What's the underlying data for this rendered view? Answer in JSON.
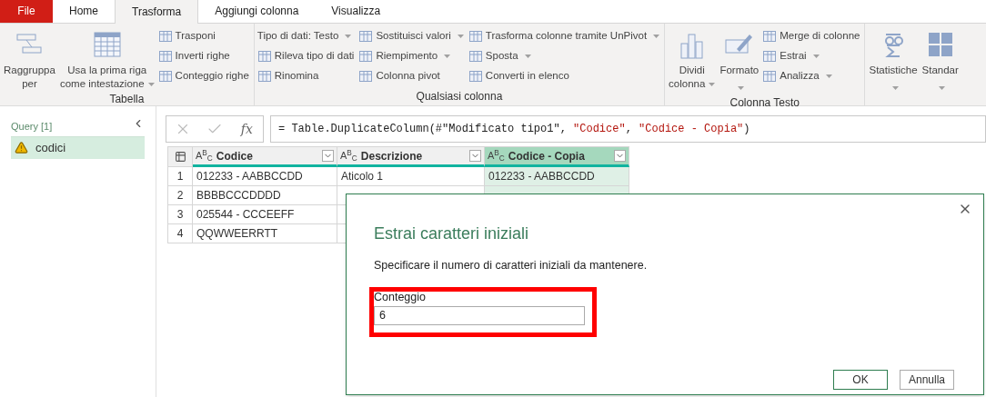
{
  "menu_tabs": [
    {
      "label": "File",
      "kind": "file",
      "selected": false
    },
    {
      "label": "Home",
      "kind": "tab",
      "selected": false
    },
    {
      "label": "Trasforma",
      "kind": "tab",
      "selected": true
    },
    {
      "label": "Aggiungi colonna",
      "kind": "tab",
      "selected": false
    },
    {
      "label": "Visualizza",
      "kind": "tab",
      "selected": false
    }
  ],
  "ribbon": {
    "groups": [
      {
        "label": "Tabella",
        "columns": [
          {
            "kind": "large",
            "lines": [
              "Raggruppa",
              "per"
            ],
            "dropdown": false
          },
          {
            "kind": "large",
            "lines": [
              "Usa la prima riga",
              "come intestazione"
            ],
            "dropdown": true
          },
          {
            "kind": "stack",
            "items": [
              {
                "label": "Trasponi",
                "dropdown": false
              },
              {
                "label": "Inverti righe",
                "dropdown": false
              },
              {
                "label": "Conteggio righe",
                "dropdown": false
              }
            ]
          }
        ]
      },
      {
        "label": "Qualsiasi colonna",
        "columns": [
          {
            "kind": "stack",
            "items": [
              {
                "label": "Tipo di dati: Testo",
                "dropdown": true,
                "no_icon": true
              },
              {
                "label": "Rileva tipo di dati",
                "dropdown": false
              },
              {
                "label": "Rinomina",
                "dropdown": false
              }
            ]
          },
          {
            "kind": "stack",
            "items": [
              {
                "label": "Sostituisci valori",
                "dropdown": true
              },
              {
                "label": "Riempimento",
                "dropdown": true
              },
              {
                "label": "Colonna pivot",
                "dropdown": false
              }
            ]
          },
          {
            "kind": "stack",
            "items": [
              {
                "label": "Trasforma colonne tramite UnPivot",
                "dropdown": true
              },
              {
                "label": "Sposta",
                "dropdown": true
              },
              {
                "label": "Converti in elenco",
                "dropdown": false
              }
            ]
          }
        ]
      },
      {
        "label": "Colonna Testo",
        "columns": [
          {
            "kind": "large",
            "lines": [
              "Dividi",
              "colonna"
            ],
            "dropdown": true
          },
          {
            "kind": "large",
            "lines": [
              "Formato"
            ],
            "dropdown": true
          },
          {
            "kind": "stack",
            "items": [
              {
                "label": "Merge di colonne",
                "dropdown": false
              },
              {
                "label": "Estrai",
                "dropdown": true
              },
              {
                "label": "Analizza",
                "dropdown": true
              }
            ]
          }
        ]
      },
      {
        "columns": [
          {
            "kind": "large",
            "lines": [
              "Statistiche"
            ],
            "dropdown": true
          },
          {
            "kind": "large",
            "lines": [
              "Standar"
            ],
            "dropdown": true
          }
        ]
      }
    ]
  },
  "queries": {
    "header": "Query [1]",
    "items": [
      {
        "name": "codici",
        "warning": true,
        "selected": true
      }
    ]
  },
  "formula_bar": {
    "fx_label": "fx",
    "formula": [
      {
        "kind": "code",
        "text": "= Table.DuplicateColumn(#\"Modificato tipo1\", "
      },
      {
        "kind": "string",
        "text": "\"Codice\""
      },
      {
        "kind": "code",
        "text": ", "
      },
      {
        "kind": "string",
        "text": "\"Codice - Copia\""
      },
      {
        "kind": "code",
        "text": ")"
      }
    ]
  },
  "table": {
    "columns": [
      {
        "type": "A$^{B}$$_{C}$",
        "name": "Codice",
        "selected": false
      },
      {
        "type": "A$^{B}$$_{C}$",
        "name": "Descrizione",
        "selected": false
      },
      {
        "type": "A$^{B}$$_{C}$",
        "name": "Codice - Copia",
        "selected": true
      }
    ],
    "rows": [
      {
        "number": "1",
        "cells": [
          "012233 - AABBCCDD",
          "Aticolo 1",
          "012233 - AABBCCDD"
        ]
      },
      {
        "number": "2",
        "cells": [
          "BBBBCCCDDDD"
        ]
      },
      {
        "number": "3",
        "cells": [
          "025544 - CCCEEFF"
        ]
      },
      {
        "number": "4",
        "cells": [
          "QQWWEERRTT"
        ]
      }
    ]
  },
  "dialog": {
    "title": "Estrai caratteri iniziali",
    "description": "Specificare il numero di caratteri iniziali da mantenere.",
    "field": {
      "label": "Conteggio",
      "value": "6",
      "highlighted": true
    },
    "buttons": [
      {
        "label": "OK",
        "kind": "primary"
      },
      {
        "label": "Annulla",
        "kind": "secondary"
      }
    ]
  }
}
